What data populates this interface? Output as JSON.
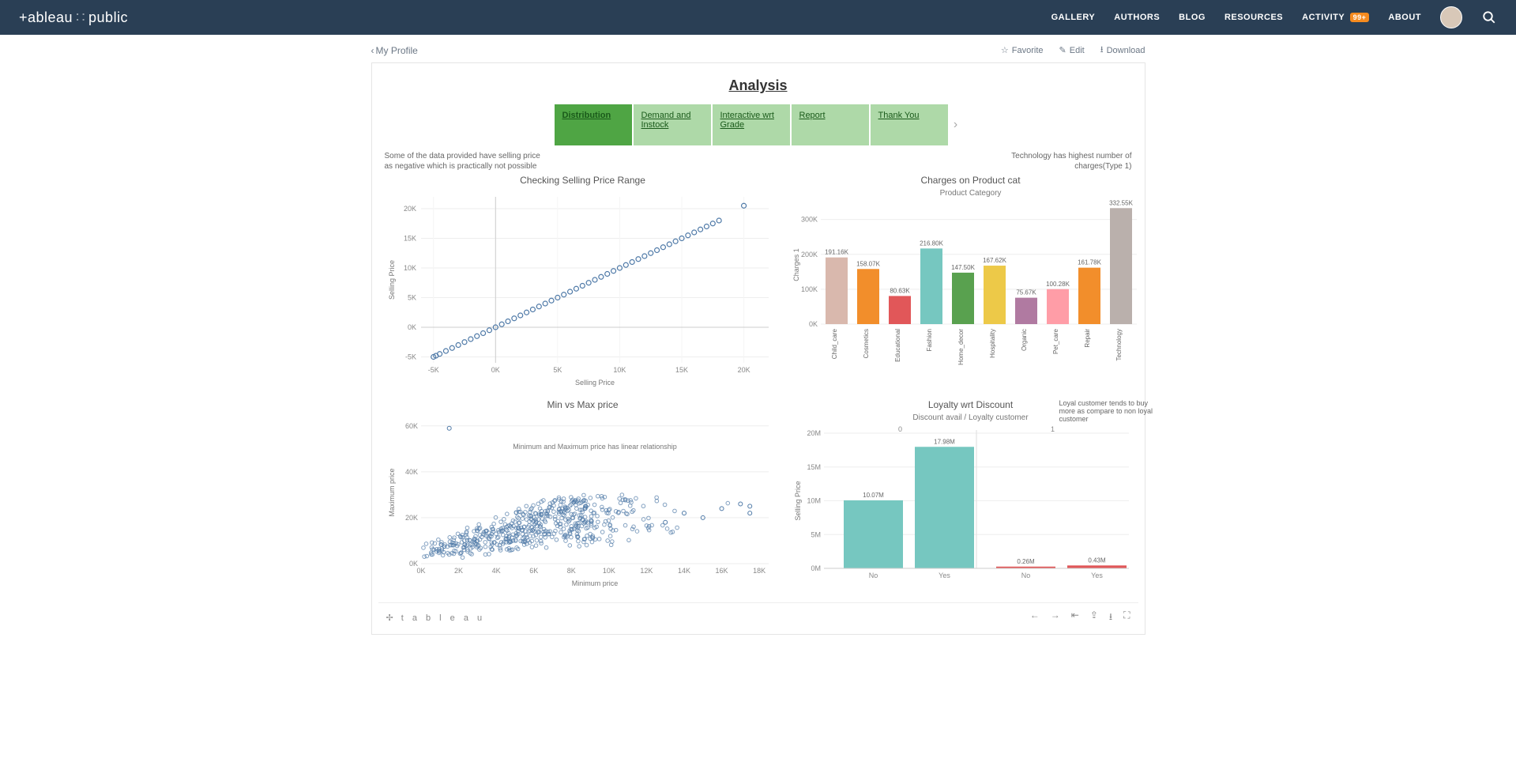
{
  "topbar": {
    "logo_left": "+ableau",
    "logo_right": "public",
    "nav": {
      "gallery": "GALLERY",
      "authors": "AUTHORS",
      "blog": "BLOG",
      "resources": "RESOURCES",
      "activity": "ACTIVITY",
      "activity_badge": "99+",
      "about": "ABOUT"
    }
  },
  "subbar": {
    "back": "My Profile",
    "favorite": "Favorite",
    "edit": "Edit",
    "download": "Download"
  },
  "viz": {
    "title": "Analysis",
    "tabs": [
      {
        "label": "Distribution",
        "active": true
      },
      {
        "label": "Demand and Instock",
        "active": false
      },
      {
        "label": "Interactive wrt Grade",
        "active": false
      },
      {
        "label": "Report",
        "active": false
      },
      {
        "label": "Thank You",
        "active": false
      }
    ],
    "note_left": "Some of the data provided have selling price as negative which is practically not possible",
    "note_right": "Technology has highest number of charges(Type 1)",
    "note_loyalty": "Loyal customer tends to buy more as compare to non loyal customer",
    "note_minmax": "Minimum and Maximum price has linear relationship"
  },
  "chart_data": [
    {
      "id": "checking_selling_price",
      "type": "scatter",
      "title": "Checking Selling Price Range",
      "xlabel": "Selling Price",
      "ylabel": "Selling Price",
      "x_ticks": [
        "-5K",
        "0K",
        "5K",
        "10K",
        "15K",
        "20K"
      ],
      "y_ticks": [
        "-5K",
        "0K",
        "5K",
        "10K",
        "15K",
        "20K"
      ],
      "xlim": [
        -6,
        22
      ],
      "ylim": [
        -6,
        22
      ],
      "series": [
        {
          "name": "points",
          "points": [
            [
              -5,
              -5
            ],
            [
              -4.8,
              -4.8
            ],
            [
              -4.5,
              -4.5
            ],
            [
              -4,
              -4
            ],
            [
              -3.5,
              -3.5
            ],
            [
              -3,
              -3
            ],
            [
              -2.5,
              -2.5
            ],
            [
              -2,
              -2
            ],
            [
              -1.5,
              -1.5
            ],
            [
              -1,
              -1
            ],
            [
              -0.5,
              -0.5
            ],
            [
              0,
              0
            ],
            [
              0.5,
              0.5
            ],
            [
              1,
              1
            ],
            [
              1.5,
              1.5
            ],
            [
              2,
              2
            ],
            [
              2.5,
              2.5
            ],
            [
              3,
              3
            ],
            [
              3.5,
              3.5
            ],
            [
              4,
              4
            ],
            [
              4.5,
              4.5
            ],
            [
              5,
              5
            ],
            [
              5.5,
              5.5
            ],
            [
              6,
              6
            ],
            [
              6.5,
              6.5
            ],
            [
              7,
              7
            ],
            [
              7.5,
              7.5
            ],
            [
              8,
              8
            ],
            [
              8.5,
              8.5
            ],
            [
              9,
              9
            ],
            [
              9.5,
              9.5
            ],
            [
              10,
              10
            ],
            [
              10.5,
              10.5
            ],
            [
              11,
              11
            ],
            [
              11.5,
              11.5
            ],
            [
              12,
              12
            ],
            [
              12.5,
              12.5
            ],
            [
              13,
              13
            ],
            [
              13.5,
              13.5
            ],
            [
              14,
              14
            ],
            [
              14.5,
              14.5
            ],
            [
              15,
              15
            ],
            [
              15.5,
              15.5
            ],
            [
              16,
              16
            ],
            [
              16.5,
              16.5
            ],
            [
              17,
              17
            ],
            [
              17.5,
              17.5
            ],
            [
              18,
              18
            ],
            [
              20,
              20.5
            ]
          ]
        }
      ]
    },
    {
      "id": "charges_product_cat",
      "type": "bar",
      "title": "Charges on Product cat",
      "subtitle": "Product Category",
      "ylabel": "Charges 1",
      "y_ticks": [
        "0K",
        "100K",
        "200K",
        "300K"
      ],
      "ylim": [
        0,
        340
      ],
      "categories": [
        "Child_care",
        "Cosmetics",
        "Educational",
        "Fashion",
        "Home_decor",
        "Hospitality",
        "Organic",
        "Pet_care",
        "Repair",
        "Technology"
      ],
      "values": [
        191.16,
        158.07,
        80.63,
        216.8,
        147.5,
        167.62,
        75.67,
        100.28,
        161.78,
        332.55
      ],
      "value_labels": [
        "191.16K",
        "158.07K",
        "80.63K",
        "216.80K",
        "147.50K",
        "167.62K",
        "75.67K",
        "100.28K",
        "161.78K",
        "332.55K"
      ],
      "colors": [
        "#d9b8ad",
        "#f28e2b",
        "#e15759",
        "#76c7c0",
        "#59a14f",
        "#edc948",
        "#b07aa1",
        "#ff9da7",
        "#f28e2b",
        "#bab0ac"
      ]
    },
    {
      "id": "min_vs_max",
      "type": "scatter",
      "title": "Min vs Max price",
      "xlabel": "Minimum price",
      "ylabel": "Maximum price",
      "annotation": "Minimum and Maximum price has linear relationship",
      "x_ticks": [
        "0K",
        "2K",
        "4K",
        "6K",
        "8K",
        "10K",
        "12K",
        "14K",
        "16K",
        "18K"
      ],
      "y_ticks": [
        "0K",
        "20K",
        "40K",
        "60K"
      ],
      "xlim": [
        0,
        18.5
      ],
      "ylim": [
        0,
        62
      ],
      "series": [
        {
          "name": "cloud",
          "note": "dense cloud roughly 0-8K x vs 0-25K y with positive trend; outlier near (1.5,59)"
        }
      ]
    },
    {
      "id": "loyalty_discount",
      "type": "bar",
      "title": "Loyalty wrt Discount",
      "subtitle": "Discount avail / Loyalty customer",
      "ylabel": "Selling Price",
      "y_ticks": [
        "0M",
        "5M",
        "10M",
        "15M",
        "20M"
      ],
      "ylim": [
        0,
        20
      ],
      "facets": [
        "0",
        "1"
      ],
      "categories": [
        "No",
        "Yes",
        "No",
        "Yes"
      ],
      "values": [
        10.07,
        17.98,
        0.26,
        0.43
      ],
      "value_labels": [
        "10.07M",
        "17.98M",
        "0.26M",
        "0.43M"
      ],
      "colors": [
        "#76c7c0",
        "#76c7c0",
        "#e15759",
        "#e15759"
      ]
    }
  ],
  "footer": {
    "logo": "t a b l e a u"
  }
}
